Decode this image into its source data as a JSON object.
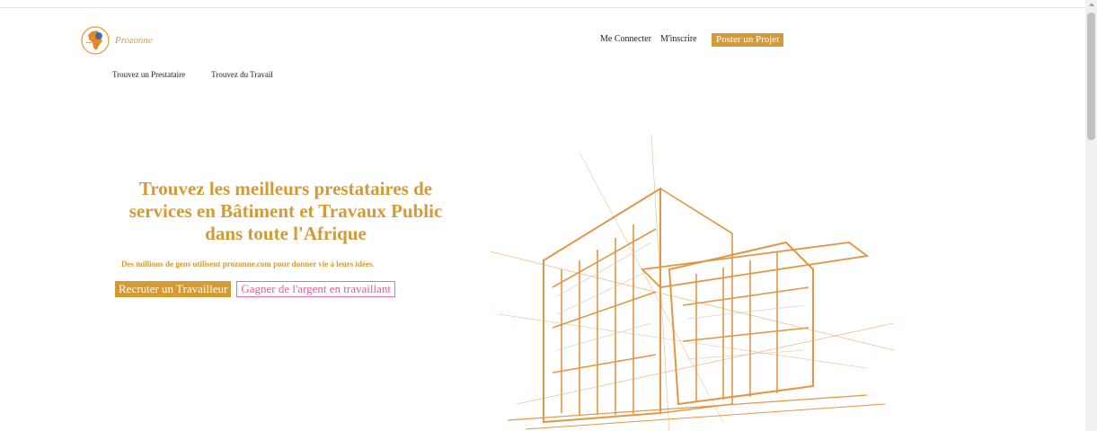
{
  "brand": {
    "name": "Prozonne"
  },
  "top_nav": {
    "login_label": "Me Connecter",
    "signup_label": "M'inscrire",
    "post_project_label": "Poster un Projet"
  },
  "sub_nav": {
    "find_provider_label": "Trouvez un Prestataire",
    "find_work_label": "Trouvez du Travail"
  },
  "hero": {
    "title_line1": "Trouvez les meilleurs prestataires de",
    "title_line2": "services en Bâtiment et Travaux Public",
    "title_line3": "dans toute l'Afrique",
    "subtitle": "Des millions de gens utilisent prozonne.com pour donner vie à leurs idées.",
    "hire_label": "Recruter un Travailleur",
    "earn_label": "Gagner de l'argent en travaillant"
  },
  "colors": {
    "accent": "#d59a34",
    "secondary": "#ea5a9a"
  }
}
